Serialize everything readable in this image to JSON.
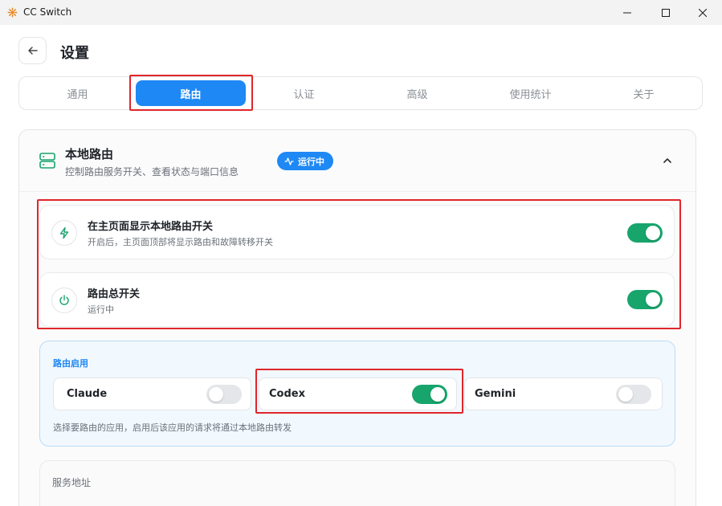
{
  "window": {
    "title": "CC Switch",
    "minimize_icon": "minimize-icon",
    "maximize_icon": "maximize-icon",
    "close_icon": "close-icon"
  },
  "header": {
    "back_icon": "arrow-left-icon",
    "title": "设置"
  },
  "tabs": [
    {
      "label": "通用",
      "active": false
    },
    {
      "label": "路由",
      "active": true
    },
    {
      "label": "认证",
      "active": false
    },
    {
      "label": "高级",
      "active": false
    },
    {
      "label": "使用统计",
      "active": false
    },
    {
      "label": "关于",
      "active": false
    }
  ],
  "section": {
    "icon": "server-icon",
    "title": "本地路由",
    "subtitle": "控制路由服务开关、查看状态与端口信息",
    "status_badge": "运行中",
    "status_icon": "activity-icon",
    "collapse_icon": "chevron-up-icon"
  },
  "settings": [
    {
      "icon": "lightning-icon",
      "title": "在主页面显示本地路由开关",
      "subtitle": "开启后，主页面顶部将显示路由和故障转移开关",
      "enabled": true
    },
    {
      "icon": "power-icon",
      "title": "路由总开关",
      "subtitle": "运行中",
      "enabled": true
    }
  ],
  "routing_apps": {
    "label": "路由启用",
    "apps": [
      {
        "name": "Claude",
        "enabled": false
      },
      {
        "name": "Codex",
        "enabled": true
      },
      {
        "name": "Gemini",
        "enabled": false
      }
    ],
    "hint": "选择要路由的应用，启用后该应用的请求将通过本地路由转发"
  },
  "service": {
    "label": "服务地址"
  },
  "colors": {
    "accent": "#1e88f5",
    "toggle_on": "#17a56c",
    "highlight": "#e0262b"
  }
}
